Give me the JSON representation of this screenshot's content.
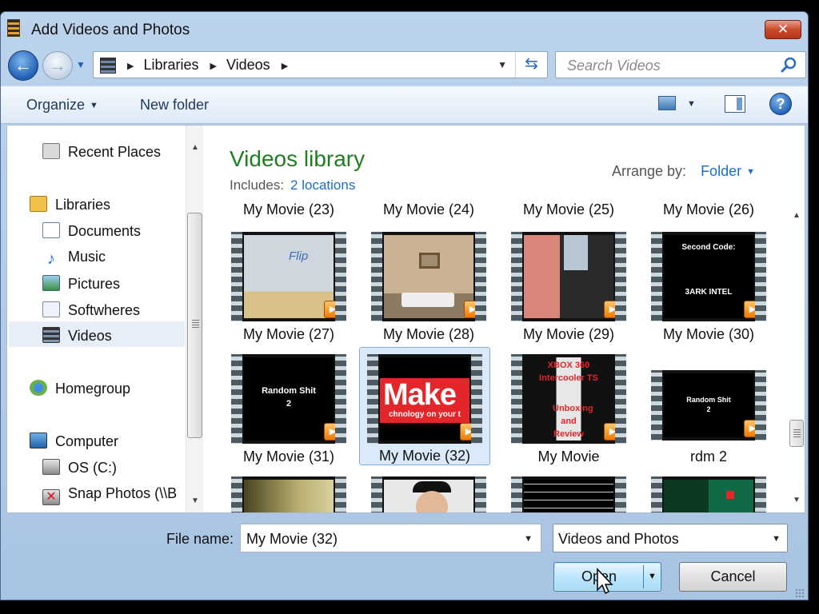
{
  "window": {
    "title": "Add Videos and Photos",
    "close_label": "✕"
  },
  "nav": {
    "back_label": "←",
    "forward_label": "→",
    "breadcrumb": [
      "Libraries",
      "Videos"
    ],
    "search_placeholder": "Search Videos"
  },
  "toolbar": {
    "organize": "Organize",
    "new_folder": "New folder",
    "help": "?"
  },
  "sidebar": {
    "items": [
      {
        "label": "Recent Places",
        "icon": "recent-places-icon"
      },
      {
        "label": "Libraries",
        "icon": "libraries-icon"
      },
      {
        "label": "Documents",
        "icon": "documents-icon"
      },
      {
        "label": "Music",
        "icon": "music-icon"
      },
      {
        "label": "Pictures",
        "icon": "pictures-icon"
      },
      {
        "label": "Softwheres",
        "icon": "library-icon"
      },
      {
        "label": "Videos",
        "icon": "videos-icon"
      },
      {
        "label": "Homegroup",
        "icon": "homegroup-icon"
      },
      {
        "label": "Computer",
        "icon": "computer-icon"
      },
      {
        "label": "OS (C:)",
        "icon": "drive-icon"
      },
      {
        "label": "Snap Photos (\\\\B",
        "icon": "network-drive-icon"
      }
    ]
  },
  "library": {
    "title": "Videos library",
    "includes_label": "Includes:",
    "includes_link": "2 locations",
    "arrange_label": "Arrange by:",
    "arrange_value": "Folder"
  },
  "top_labels": [
    "My Movie (23)",
    "My Movie (24)",
    "My Movie (25)",
    "My Movie (26)"
  ],
  "tiles": [
    {
      "label": "My Movie (27)",
      "frame_text": "Flip"
    },
    {
      "label": "My Movie (28)",
      "frame_text": ""
    },
    {
      "label": "My Movie (29)",
      "frame_text": ""
    },
    {
      "label": "My Movie (30)",
      "frame_text": "Second Code:",
      "frame_text2": "3ARK INTEL"
    },
    {
      "label": "My Movie (31)",
      "frame_text": "Random Shit",
      "frame_text2": "2"
    },
    {
      "label": "My Movie (32)",
      "frame_text": "Make",
      "frame_text2": "chnology on your t"
    },
    {
      "label": "My Movie",
      "frame_text": "XBOX 360",
      "frame_text2": "Intercooler TS",
      "frame_text3": "Unboxing and Review"
    },
    {
      "label": "rdm 2",
      "frame_text": "Random Shit",
      "frame_text2": "2"
    }
  ],
  "file_name": {
    "label": "File name:",
    "value": "My Movie (32)"
  },
  "filter": {
    "value": "Videos and Photos"
  },
  "buttons": {
    "open": "Open",
    "cancel": "Cancel"
  },
  "colors": {
    "library_title": "#1e7f1e",
    "link": "#1b6fc8",
    "accent": "#1f5fb4"
  }
}
